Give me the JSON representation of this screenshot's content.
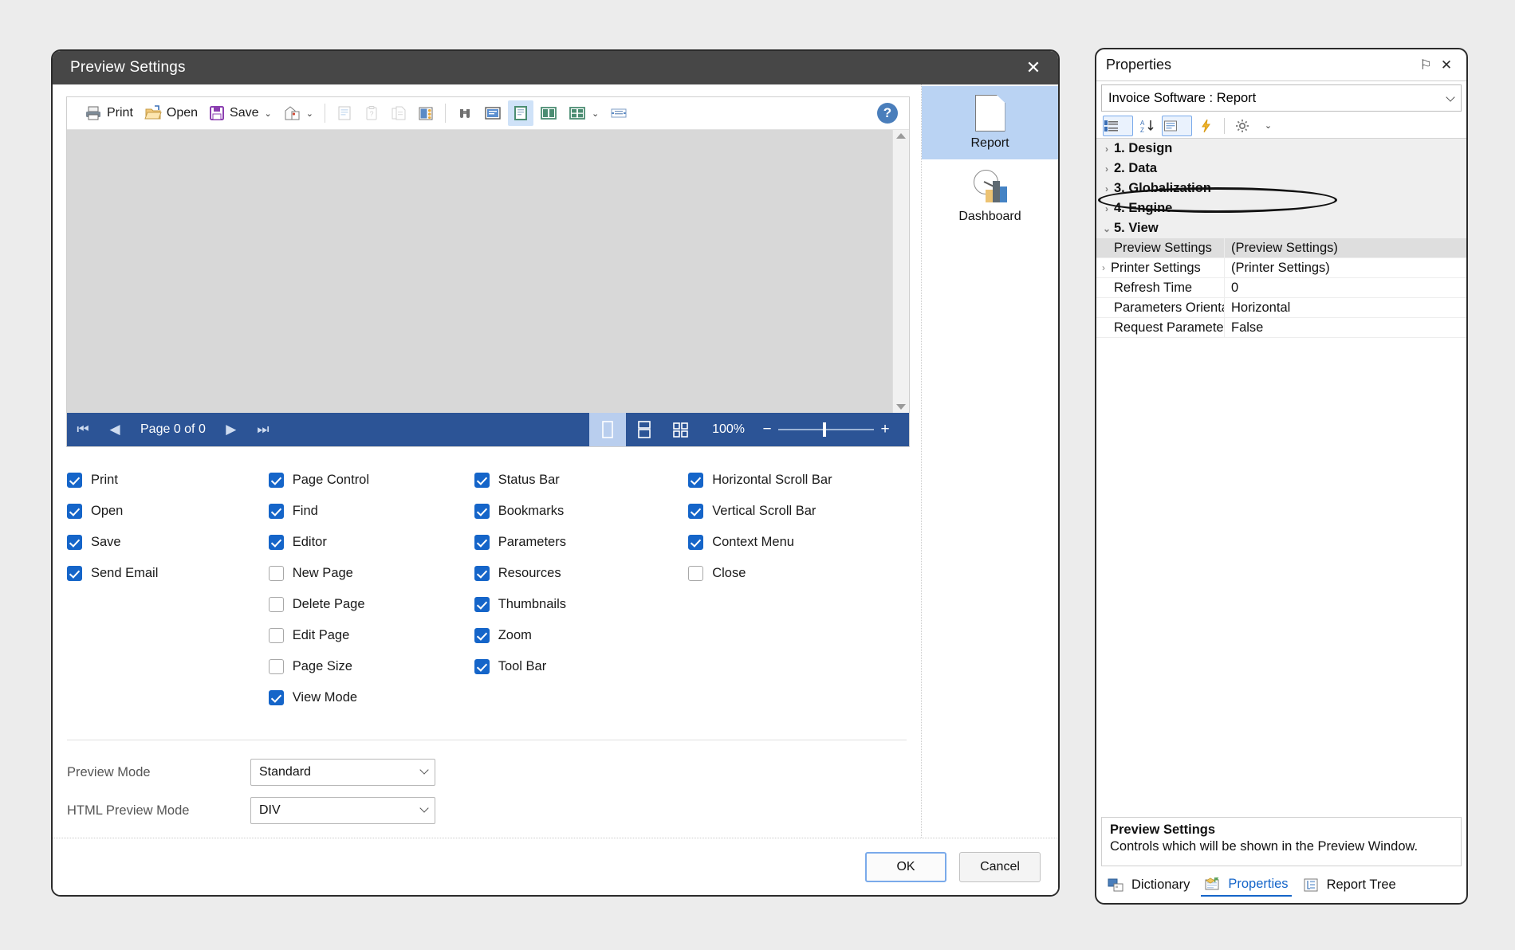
{
  "dialog": {
    "title": "Preview Settings",
    "close_label": "✕",
    "toolbar": {
      "print": "Print",
      "open": "Open",
      "save": "Save",
      "caret": "⌄",
      "help": "?"
    },
    "navbar": {
      "first": "⏮",
      "prev": "◀",
      "page_label": "Page 0 of 0",
      "next": "▶",
      "last": "⏭",
      "zoom_level": "100%",
      "minus": "−",
      "plus": "+"
    },
    "checkbox_columns": [
      [
        {
          "label": "Print",
          "checked": true
        },
        {
          "label": "Open",
          "checked": true
        },
        {
          "label": "Save",
          "checked": true
        },
        {
          "label": "Send Email",
          "checked": true
        }
      ],
      [
        {
          "label": "Page Control",
          "checked": true
        },
        {
          "label": "Find",
          "checked": true
        },
        {
          "label": "Editor",
          "checked": true
        },
        {
          "label": "New Page",
          "checked": false
        },
        {
          "label": "Delete Page",
          "checked": false
        },
        {
          "label": "Edit Page",
          "checked": false
        },
        {
          "label": "Page Size",
          "checked": false
        },
        {
          "label": "View Mode",
          "checked": true
        }
      ],
      [
        {
          "label": "Status Bar",
          "checked": true
        },
        {
          "label": "Bookmarks",
          "checked": true
        },
        {
          "label": "Parameters",
          "checked": true
        },
        {
          "label": "Resources",
          "checked": true
        },
        {
          "label": "Thumbnails",
          "checked": true
        },
        {
          "label": "Zoom",
          "checked": true
        },
        {
          "label": "Tool Bar",
          "checked": true
        }
      ],
      [
        {
          "label": "Horizontal Scroll Bar",
          "checked": true
        },
        {
          "label": "Vertical Scroll Bar",
          "checked": true
        },
        {
          "label": "Context Menu",
          "checked": true
        },
        {
          "label": "Close",
          "checked": false
        }
      ]
    ],
    "modes": [
      {
        "label": "Preview Mode",
        "value": "Standard"
      },
      {
        "label": "HTML Preview Mode",
        "value": "DIV"
      }
    ],
    "footer": {
      "ok": "OK",
      "cancel": "Cancel"
    },
    "rail": [
      {
        "label": "Report",
        "active": true
      },
      {
        "label": "Dashboard",
        "active": false
      }
    ]
  },
  "properties": {
    "title": "Properties",
    "pin": "⚐",
    "close": "✕",
    "object": "Invoice Software : Report",
    "categories": [
      {
        "label": "1. Design",
        "expanded": false
      },
      {
        "label": "2. Data",
        "expanded": false
      },
      {
        "label": "3. Globalization",
        "expanded": false
      },
      {
        "label": "4. Engine",
        "expanded": false
      },
      {
        "label": "5. View",
        "expanded": true
      }
    ],
    "rows": [
      {
        "name": "Preview Settings",
        "value": "(Preview Settings)",
        "expandable": false,
        "highlight": true
      },
      {
        "name": "Printer Settings",
        "value": "(Printer Settings)",
        "expandable": true,
        "highlight": false
      },
      {
        "name": "Refresh Time",
        "value": "0",
        "expandable": false,
        "highlight": false
      },
      {
        "name": "Parameters Orientation",
        "value": "Horizontal",
        "expandable": false,
        "highlight": false
      },
      {
        "name": "Request Parameters",
        "value": "False",
        "expandable": false,
        "highlight": false
      }
    ],
    "description": {
      "title": "Preview Settings",
      "text": "Controls which will be shown in the Preview Window."
    },
    "tabs": [
      {
        "label": "Dictionary",
        "active": false
      },
      {
        "label": "Properties",
        "active": true
      },
      {
        "label": "Report Tree",
        "active": false
      }
    ]
  },
  "colors": {
    "accent_blue": "#1565c9",
    "navbar_blue": "#2c5496",
    "titlebar_gray": "#474747",
    "page_bg": "#ececec"
  }
}
